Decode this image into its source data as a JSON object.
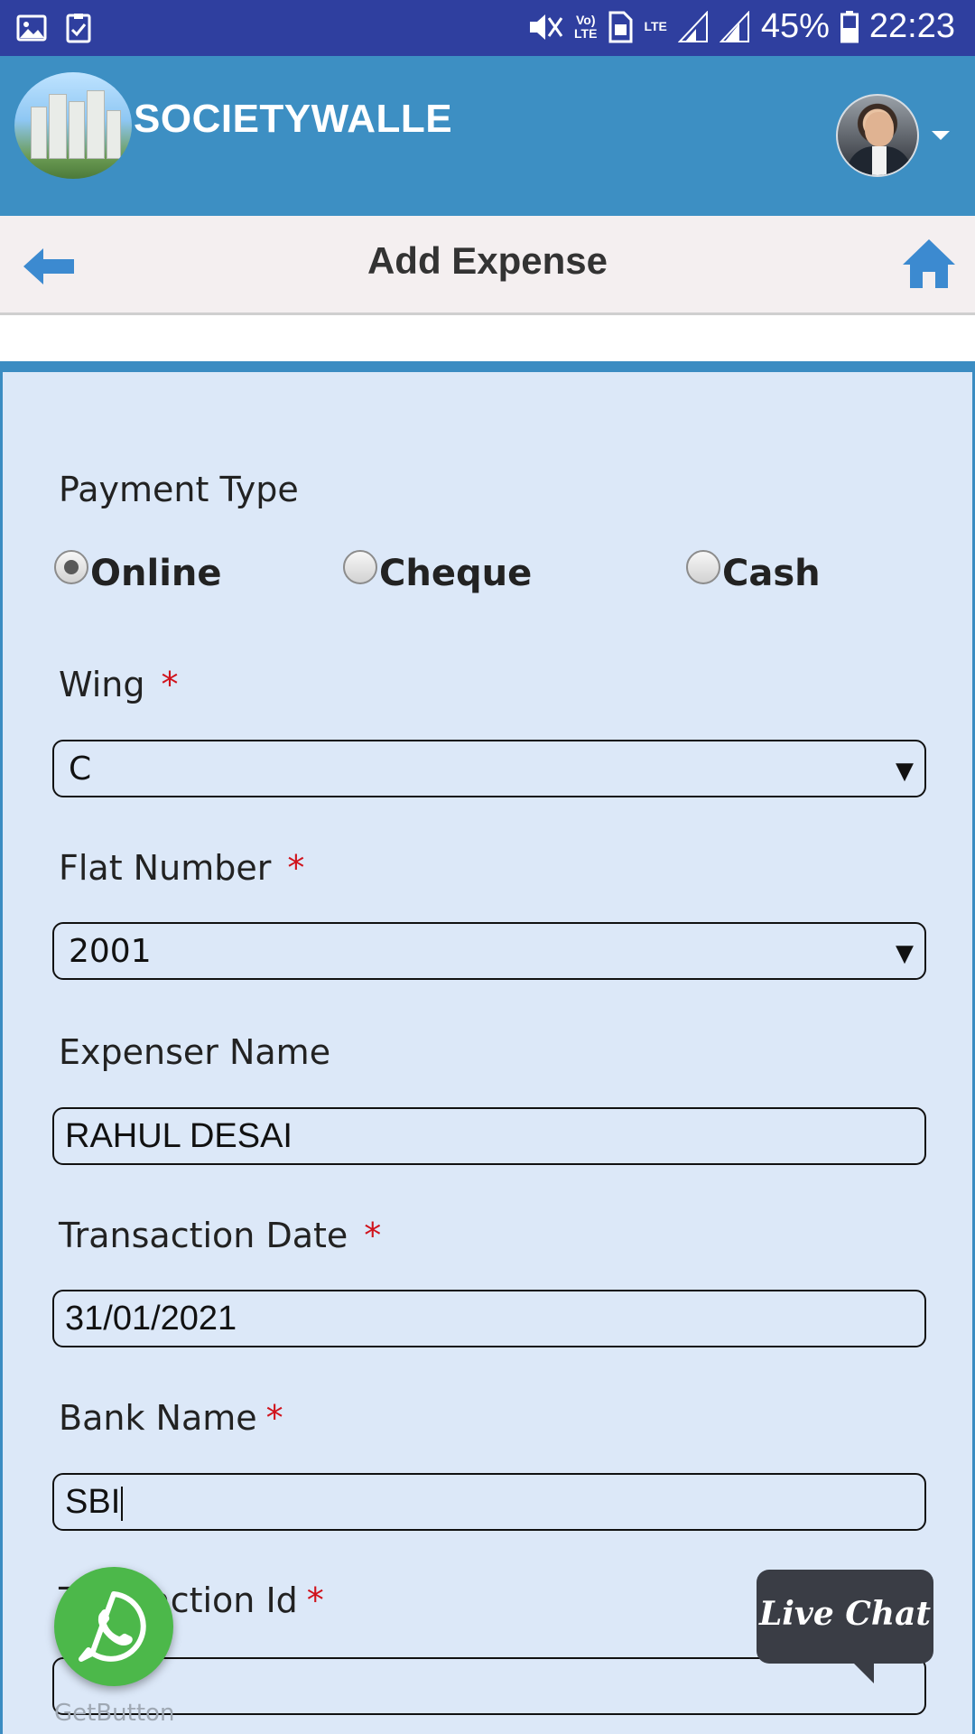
{
  "status_bar": {
    "vol_label": "Vo)",
    "lte_small": "LTE",
    "lte_label": "LTE",
    "battery": "45%",
    "time": "22:23"
  },
  "header": {
    "brand": "SOCIETYWALLE"
  },
  "titlebar": {
    "title": "Add Expense"
  },
  "form": {
    "payment_type_label": "Payment Type",
    "payment_options": [
      "Online",
      "Cheque",
      "Cash"
    ],
    "payment_selected": "Online",
    "wing_label": "Wing",
    "wing_value": "C",
    "flat_label": "Flat Number",
    "flat_value": "2001",
    "expenser_label": "Expenser Name",
    "expenser_value": "RAHUL DESAI",
    "date_label": "Transaction Date",
    "date_value": "31/01/2021",
    "bank_label": "Bank Name",
    "bank_value": "SBI",
    "txn_label": "Transaction Id",
    "txn_value": "",
    "required_mark": "*",
    "dropdown_arrow": "▼"
  },
  "widgets": {
    "getbutton": "GetButton",
    "live_chat": "Live Chat"
  },
  "colors": {
    "status_bar": "#2f3f9f",
    "app_bar": "#3d8fc3",
    "panel_bg": "#dce8f8",
    "panel_border": "#3b8cc2",
    "required": "#d0131c",
    "whatsapp": "#4cb84a",
    "live_chat": "#3a3d45"
  }
}
